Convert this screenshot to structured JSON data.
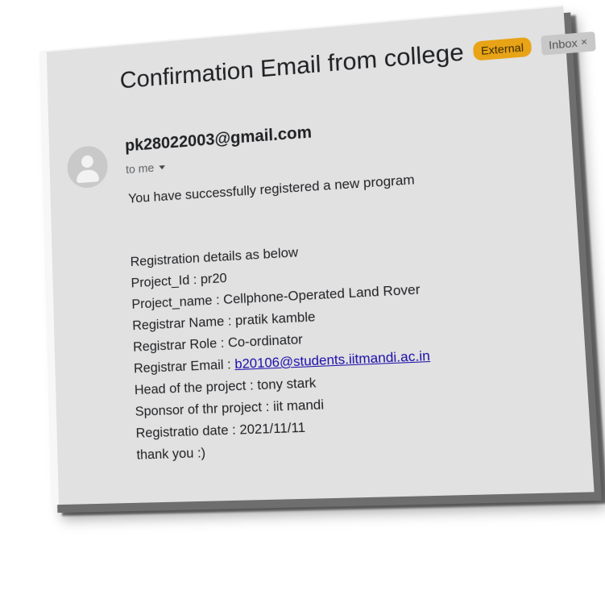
{
  "email": {
    "subject": "Confirmation Email from college",
    "labels": {
      "external": "External",
      "inbox": "Inbox",
      "inbox_close": "×"
    },
    "sender": "pk28022003@gmail.com",
    "recipient_line": "to me",
    "body": {
      "intro": "You have successfully registered a new program",
      "details_heading": "Registration details as below",
      "project_id": "Project_Id : pr20",
      "project_name": "Project_name : Cellphone-Operated Land Rover",
      "registrar_name": "Registrar Name : pratik kamble",
      "registrar_role": "Registrar Role : Co-ordinator",
      "registrar_email_label": "Registrar Email : ",
      "registrar_email_link": "b20106@students.iitmandi.ac.in",
      "head_of_project": "Head of the project : tony stark",
      "sponsor": "Sponsor of thr project : iit mandi",
      "registration_date": "Registratio date : 2021/11/11",
      "closing": "thank you :)"
    }
  },
  "colors": {
    "external_badge": "#e8a317",
    "inbox_badge": "#c8c8c8",
    "link": "#1a0dab",
    "card_background": "#e1e1e1"
  },
  "icons": {
    "avatar": "person-avatar-icon",
    "recipient_dropdown": "caret-down-icon",
    "inbox_remove": "close-icon"
  }
}
